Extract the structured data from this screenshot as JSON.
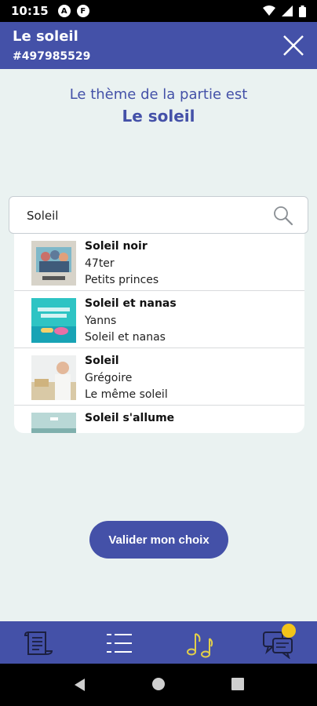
{
  "status_bar": {
    "time": "10:15",
    "app_icons": [
      "A",
      "F"
    ],
    "right_icons": [
      "wifi-icon",
      "signal-icon",
      "battery-icon"
    ]
  },
  "header": {
    "title": "Le soleil",
    "game_id": "#497985529",
    "close_icon": "close-icon"
  },
  "theme": {
    "intro": "Le thème de la partie est",
    "name": "Le soleil"
  },
  "search": {
    "value": "Soleil",
    "icon": "search-icon"
  },
  "results": [
    {
      "title": "Soleil noir",
      "artist": "47ter",
      "album": "Petits princes"
    },
    {
      "title": "Soleil et nanas",
      "artist": "Yanns",
      "album": "Soleil et nanas"
    },
    {
      "title": "Soleil",
      "artist": "Grégoire",
      "album": "Le même soleil"
    },
    {
      "title": "Soleil s'allume",
      "artist": "",
      "album": ""
    }
  ],
  "validate_label": "Valider mon choix",
  "tabs": [
    {
      "icon": "scroll-icon",
      "active": false
    },
    {
      "icon": "list-icon",
      "active": false
    },
    {
      "icon": "music-notes-icon",
      "active": true
    },
    {
      "icon": "chat-icon",
      "active": false,
      "badge": true
    }
  ],
  "colors": {
    "primary": "#4451a8",
    "background": "#eaf2f1",
    "accent": "#f2c41a",
    "active_icon": "#e2cf4a"
  }
}
